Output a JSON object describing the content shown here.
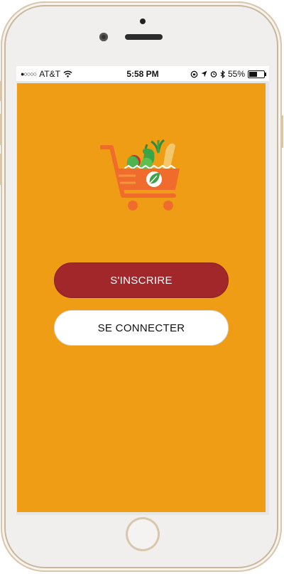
{
  "status_bar": {
    "signal": "●○○○○",
    "carrier": "AT&T",
    "wifi_icon": "wifi-icon",
    "time": "5:58 PM",
    "battery_percent": "55%",
    "battery_level": 0.55
  },
  "app": {
    "background_color": "#f09d16",
    "logo_icon": "shopping-cart-vegetables-icon",
    "buttons": {
      "signup_label": "S'INSCRIRE",
      "login_label": "SE CONNECTER"
    }
  },
  "colors": {
    "primary_button": "#a1272a",
    "secondary_button": "#ffffff",
    "cart_orange": "#ef6c2c"
  }
}
